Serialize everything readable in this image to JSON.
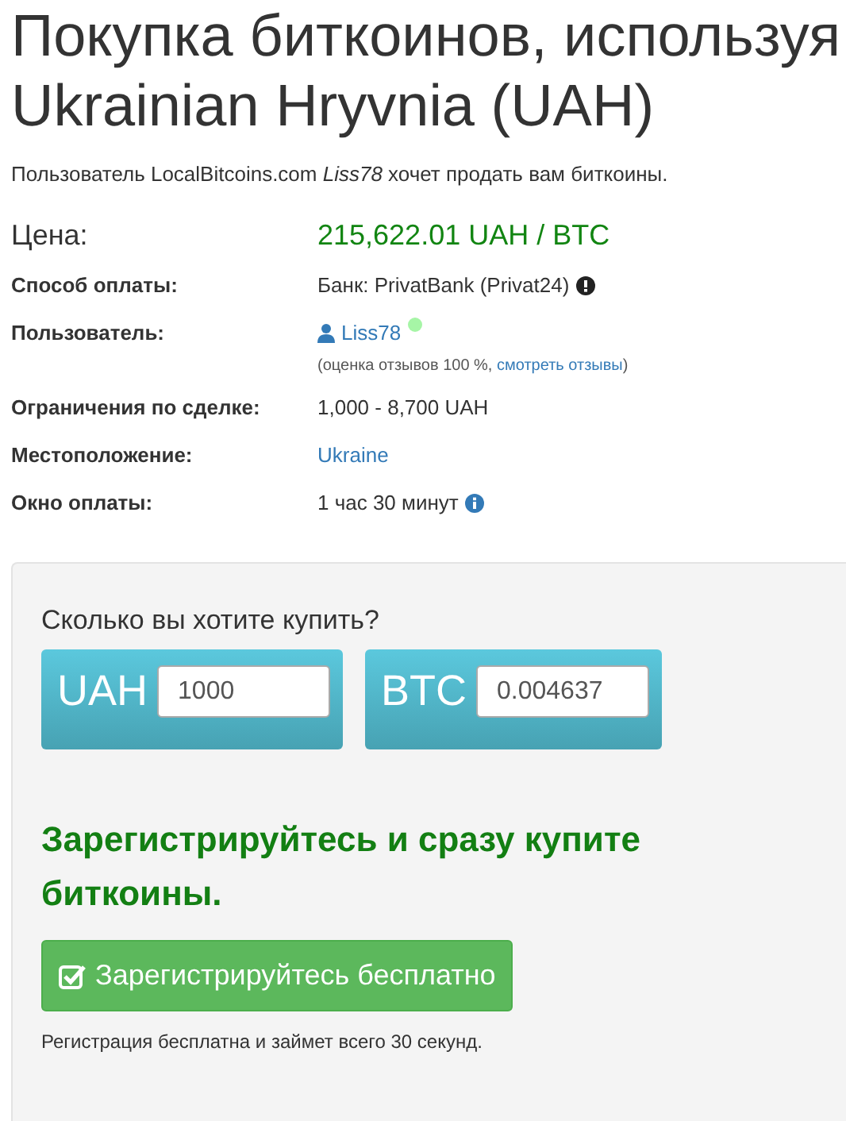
{
  "title_lines": [
    "Покупка биткоинов, используя",
    "Ukrainian Hryvnia (UAH)"
  ],
  "intro": "Пользователь LocalBitcoins.com *Liss78* хочет продать вам биткоины.",
  "details": [
    {
      "kind": "price",
      "label": "Цена:",
      "value": "215,622.01 UAH / BTC"
    },
    {
      "kind": "warning",
      "label": "Способ оплаты:",
      "value": "Банк: PrivatBank (Privat24)"
    },
    {
      "kind": "user",
      "label": "Пользователь:",
      "value": "Liss78",
      "online": true,
      "feedback_prefix": "(оценка отзывов 100 %, ",
      "feedback_link": "смотреть отзывы",
      "feedback_suffix": ")"
    },
    {
      "kind": "text",
      "label": "Ограничения по сделке:",
      "value": "1,000 - 8,700 UAH"
    },
    {
      "kind": "link",
      "label": "Местоположение:",
      "value": "Ukraine"
    },
    {
      "kind": "info",
      "label": "Окно оплаты:",
      "value": "1 час 30 минут"
    }
  ],
  "buy": {
    "question": "Сколько вы хотите купить?",
    "amounts": [
      {
        "currency": "UAH",
        "value": "1000"
      },
      {
        "currency": "BTC",
        "value": "0.004637"
      }
    ],
    "cta": "Зарегистрируйтесь и сразу купите биткоины.",
    "register_button": "Зарегистрируйтесь бесплатно",
    "note": "Регистрация бесплатна и займет всего 30 секунд."
  }
}
